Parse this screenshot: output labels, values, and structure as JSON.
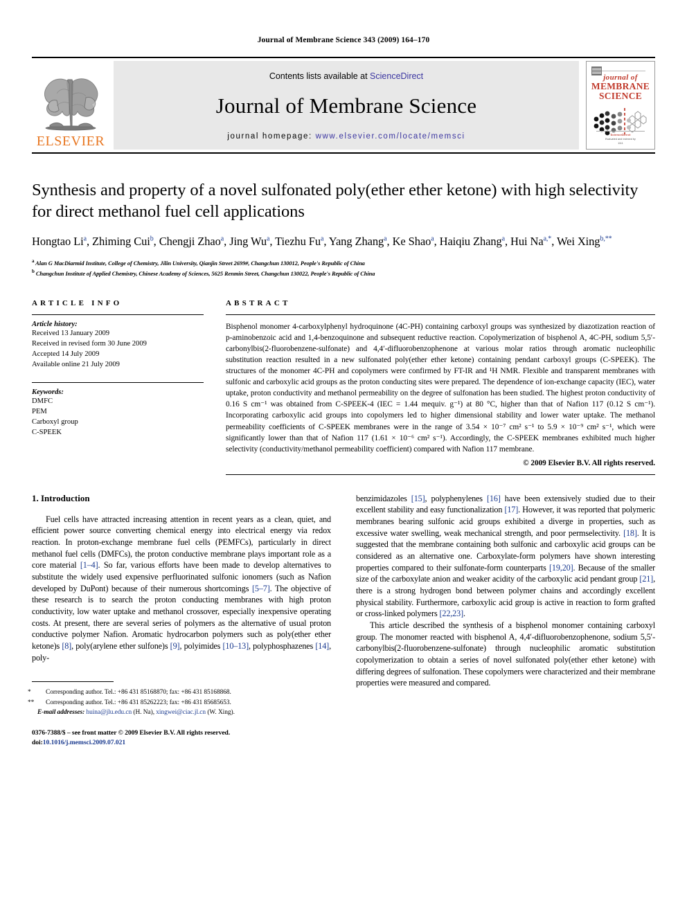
{
  "running_head": "Journal of Membrane Science 343 (2009) 164–170",
  "masthead": {
    "publisher_name": "ELSEVIER",
    "contents_prefix": "Contents lists available at ",
    "sciencedirect": "ScienceDirect",
    "journal_title": "Journal of Membrane Science",
    "homepage_prefix": "journal homepage: ",
    "homepage_url": "www.elsevier.com/locate/memsci",
    "cover": {
      "line1": "journal of",
      "line2": "MEMBRANE",
      "line3": "SCIENCE",
      "footer1": "ScienceDirect",
      "footer2": "Evaluated and indexed by",
      "footer3": "1111"
    }
  },
  "title": "Synthesis and property of a novel sulfonated poly(ether ether ketone) with high selectivity for direct methanol fuel cell applications",
  "authors": [
    {
      "name": "Hongtao Li",
      "sup": "a"
    },
    {
      "name": "Zhiming Cui",
      "sup": "b"
    },
    {
      "name": "Chengji Zhao",
      "sup": "a"
    },
    {
      "name": "Jing Wu",
      "sup": "a"
    },
    {
      "name": "Tiezhu Fu",
      "sup": "a"
    },
    {
      "name": "Yang Zhang",
      "sup": "a"
    },
    {
      "name": "Ke Shao",
      "sup": "a"
    },
    {
      "name": "Haiqiu Zhang",
      "sup": "a"
    },
    {
      "name": "Hui Na",
      "sup": "a,*"
    },
    {
      "name": "Wei Xing",
      "sup": "b,**"
    }
  ],
  "affiliations": [
    {
      "mark": "a",
      "text": "Alan G MacDiarmid Institute, College of Chemistry, Jilin University, Qianjin Street 2699#, Changchun 130012, People's Republic of China"
    },
    {
      "mark": "b",
      "text": "Changchun Institute of Applied Chemistry, Chinese Academy of Sciences, 5625 Renmin Street, Changchun 130022, People's Republic of China"
    }
  ],
  "article_info": {
    "heading": "ARTICLE INFO",
    "history_label": "Article history:",
    "history": [
      "Received 13 January 2009",
      "Received in revised form 30 June 2009",
      "Accepted 14 July 2009",
      "Available online 21 July 2009"
    ],
    "keywords_label": "Keywords:",
    "keywords": [
      "DMFC",
      "PEM",
      "Carboxyl group",
      "C-SPEEK"
    ]
  },
  "abstract": {
    "heading": "ABSTRACT",
    "text": "Bisphenol monomer 4-carboxylphenyl hydroquinone (4C-PH) containing carboxyl groups was synthesized by diazotization reaction of p-aminobenzoic acid and 1,4-benzoquinone and subsequent reductive reaction. Copolymerization of bisphenol A, 4C-PH, sodium 5,5′-carbonylbis(2-fluorobenzene-sulfonate) and 4,4′-difluorobenzophenone at various molar ratios through aromatic nucleophilic substitution reaction resulted in a new sulfonated poly(ether ether ketone) containing pendant carboxyl groups (C-SPEEK). The structures of the monomer 4C-PH and copolymers were confirmed by FT-IR and ¹H NMR. Flexible and transparent membranes with sulfonic and carboxylic acid groups as the proton conducting sites were prepared. The dependence of ion-exchange capacity (IEC), water uptake, proton conductivity and methanol permeability on the degree of sulfonation has been studied. The highest proton conductivity of 0.16 S cm⁻¹ was obtained from C-SPEEK-4 (IEC = 1.44 mequiv. g⁻¹) at 80 °C, higher than that of Nafion 117 (0.12 S cm⁻¹). Incorporating carboxylic acid groups into copolymers led to higher dimensional stability and lower water uptake. The methanol permeability coefficients of C-SPEEK membranes were in the range of 3.54 × 10⁻⁷ cm² s⁻¹ to 5.9 × 10⁻⁹ cm² s⁻¹, which were significantly lower than that of Nafion 117 (1.61 × 10⁻⁶ cm² s⁻¹). Accordingly, the C-SPEEK membranes exhibited much higher selectivity (conductivity/methanol permeability coefficient) compared with Nafion 117 membrane.",
    "copyright": "© 2009 Elsevier B.V. All rights reserved."
  },
  "section1": {
    "heading": "1. Introduction",
    "left_para1_a": "Fuel cells have attracted increasing attention in recent years as a clean, quiet, and efficient power source converting chemical energy into electrical energy via redox reaction. In proton-exchange membrane fuel cells (PEMFCs), particularly in direct methanol fuel cells (DMFCs), the proton conductive membrane plays important role as a core material ",
    "ref_1_4": "[1–4]",
    "left_para1_b": ". So far, various efforts have been made to develop alternatives to substitute the widely used expensive perfluorinated sulfonic ionomers (such as Nafion developed by DuPont) because of their numerous shortcomings ",
    "ref_5_7": "[5–7]",
    "left_para1_c": ". The objective of these research is to search the proton conducting membranes with high proton conductivity, low water uptake and methanol crossover, especially inexpensive operating costs. At present, there are several series of polymers as the alternative of usual proton conductive polymer Nafion. Aromatic hydrocarbon polymers such as poly(ether ether ketone)s ",
    "ref_8": "[8]",
    "left_para1_d": ", poly(arylene ether sulfone)s ",
    "ref_9": "[9]",
    "left_para1_e": ", polyimides ",
    "ref_10_13": "[10–13]",
    "left_para1_f": ", polyphosphazenes ",
    "ref_14": "[14]",
    "left_para1_g": ", poly-",
    "right_para1_a": "benzimidazoles ",
    "ref_15": "[15]",
    "right_para1_b": ", polyphenylenes ",
    "ref_16": "[16]",
    "right_para1_c": " have been extensively studied due to their excellent stability and easy functionalization ",
    "ref_17": "[17]",
    "right_para1_d": ". However, it was reported that polymeric membranes bearing sulfonic acid groups exhibited a diverge in properties, such as excessive water swelling, weak mechanical strength, and poor permselectivity. ",
    "ref_18": "[18]",
    "right_para1_e": ". It is suggested that the membrane containing both sulfonic and carboxylic acid groups can be considered as an alternative one. Carboxylate-form polymers have shown interesting properties compared to their sulfonate-form counterparts ",
    "ref_19_20": "[19,20]",
    "right_para1_f": ". Because of the smaller size of the carboxylate anion and weaker acidity of the carboxylic acid pendant group ",
    "ref_21": "[21]",
    "right_para1_g": ", there is a strong hydrogen bond between polymer chains and accordingly excellent physical stability. Furthermore, carboxylic acid group is active in reaction to form grafted or cross-linked polymers ",
    "ref_22_23": "[22,23]",
    "right_para1_h": ".",
    "right_para2": "This article described the synthesis of a bisphenol monomer containing carboxyl group. The monomer reacted with bisphenol A, 4,4′-difluorobenzophenone, sodium 5,5′-carbonylbis(2-fluorobenzene-sulfonate) through nucleophilic aromatic substitution copolymerization to obtain a series of novel sulfonated poly(ether ether ketone) with differing degrees of sulfonation. These copolymers were characterized and their membrane properties were measured and compared."
  },
  "footnotes": {
    "note1_mark": "*",
    "note1": "Corresponding author. Tel.: +86 431 85168870; fax: +86 431 85168868.",
    "note2_mark": "**",
    "note2": "Corresponding author. Tel.: +86 431 85262223; fax: +86 431 85685653.",
    "email_label": "E-mail addresses:",
    "email1": "huina@jlu.edu.cn",
    "email1_who": "(H. Na),",
    "email2": "xingwei@ciac.jl.cn",
    "email2_who": "(W. Xing).",
    "issn_line": "0376-7388/$ – see front matter © 2009 Elsevier B.V. All rights reserved.",
    "doi_label": "doi:",
    "doi_value": "10.1016/j.memsci.2009.07.021"
  },
  "colors": {
    "link_blue": "#1a3a8f",
    "sciencedirect_blue": "#3a34a0",
    "elsevier_orange": "#E87722",
    "cover_red": "#c0392b",
    "band_gray": "#e8e8e8"
  }
}
